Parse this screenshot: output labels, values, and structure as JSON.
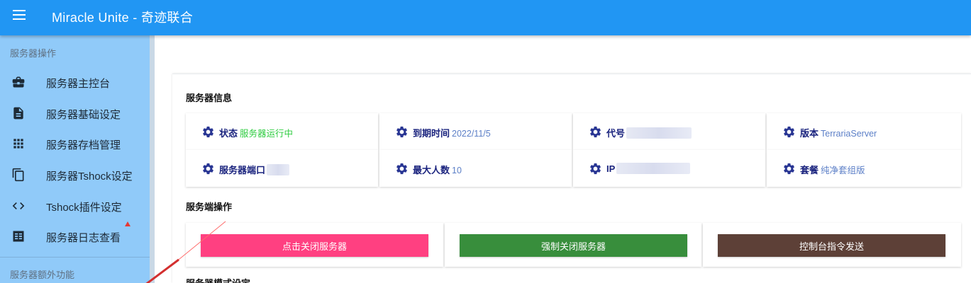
{
  "app": {
    "title": "Miracle Unite - 奇迹联合"
  },
  "sidebar": {
    "section1_title": "服务器操作",
    "items": [
      {
        "label": "服务器主控台",
        "icon": "briefcase-icon"
      },
      {
        "label": "服务器基础设定",
        "icon": "document-icon"
      },
      {
        "label": "服务器存档管理",
        "icon": "apps-grid-icon"
      },
      {
        "label": "服务器Tshock设定",
        "icon": "copy-icon"
      },
      {
        "label": "Tshock插件设定",
        "icon": "code-icon"
      },
      {
        "label": "服务器日志查看",
        "icon": "receipt-icon"
      }
    ],
    "section2_title": "服务器额外功能"
  },
  "server_info": {
    "title": "服务器信息",
    "status": {
      "label": "状态",
      "value": "服务器运行中",
      "color": "#2ecc40"
    },
    "expiry": {
      "label": "到期时间",
      "value": "2022/11/5"
    },
    "code": {
      "label": "代号",
      "value": ""
    },
    "version": {
      "label": "版本",
      "value": "TerrariaServer"
    },
    "port": {
      "label": "服务器端口",
      "value": ""
    },
    "max_players": {
      "label": "最大人数",
      "value": "10"
    },
    "ip": {
      "label": "IP",
      "value": ""
    },
    "package": {
      "label": "套餐",
      "value": "纯净套组版"
    }
  },
  "server_ops": {
    "title": "服务端操作",
    "stop_label": "点击关闭服务器",
    "force_stop_label": "强制关闭服务器",
    "console_label": "控制台指令发送"
  },
  "mode_settings": {
    "title": "服务器模式设定"
  },
  "colors": {
    "appbar": "#2196f3",
    "drawer": "#90caf9",
    "stop": "#ff4081",
    "force_stop": "#388e3c",
    "console": "#5d4037",
    "value_blue": "#5c7fc7",
    "icon_navy": "#283593"
  }
}
